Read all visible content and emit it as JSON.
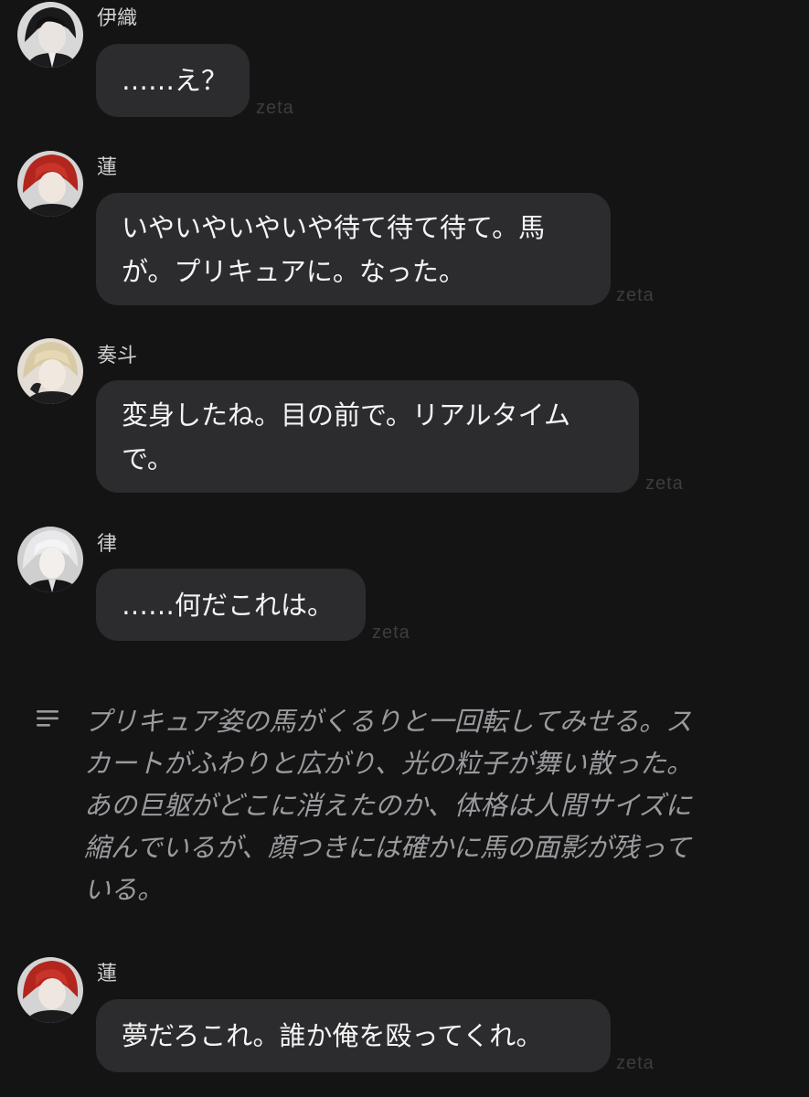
{
  "chat": {
    "messages": [
      {
        "sender": "伊織",
        "lines": [
          "……え？"
        ],
        "watermark": "zeta",
        "avatar": "dark-haired-man-avatar"
      },
      {
        "sender": "蓮",
        "lines": [
          "いやいやいやいや待て待て待て。馬",
          "が。プリキュアに。なった。"
        ],
        "watermark": "zeta",
        "avatar": "red-haired-man-avatar"
      },
      {
        "sender": "奏斗",
        "lines": [
          "変身したね。目の前で。リアルタイム",
          "で。"
        ],
        "watermark": "zeta",
        "avatar": "blond-man-avatar"
      },
      {
        "sender": "律",
        "lines": [
          "……何だこれは。"
        ],
        "watermark": "zeta",
        "avatar": "silver-haired-man-avatar"
      }
    ],
    "narration": {
      "icon": "narration-lines-icon",
      "lines": [
        "プリキュア姿の馬がくるりと一回転してみせる。ス",
        "カートがふわりと広がり、光の粒子が舞い散った。",
        "あの巨躯がどこに消えたのか、体格は人間サイズに",
        "縮んでいるが、顔つきには確かに馬の面影が残って",
        "いる。"
      ]
    },
    "last_message": {
      "sender": "蓮",
      "lines": [
        "夢だろこれ。誰か俺を殴ってくれ。"
      ],
      "watermark": "zeta",
      "avatar": "red-haired-man-avatar"
    }
  },
  "colors": {
    "background": "#141415",
    "bubble": "#2c2c2f",
    "text": "#f4f4f4",
    "sender": "#cfcfcf",
    "narration": "#9b9b9f",
    "watermark": "#3d3d40"
  }
}
